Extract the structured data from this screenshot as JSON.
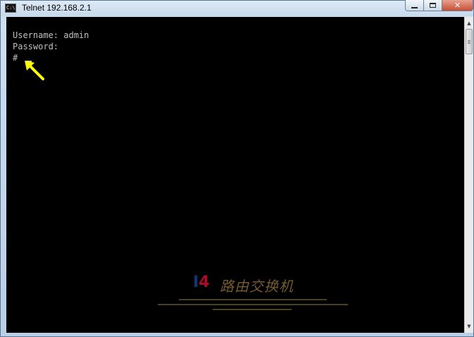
{
  "window": {
    "title": "Telnet 192.168.2.1",
    "icon_label": "C:\\",
    "controls": [
      "minimize-icon",
      "maximize-icon",
      "close-icon"
    ]
  },
  "console": {
    "lines": [
      "Username: admin",
      "Password:",
      "# "
    ],
    "cursor": "block-cursor",
    "annotation": "yellow-arrow-icon"
  },
  "watermark": {
    "logo_part1": "I",
    "logo_part2": "4",
    "brand": "路由交换机"
  },
  "colors": {
    "console_bg": "#000000",
    "console_text": "#c0c0c0",
    "arrow": "#ffff00",
    "titlebar": "#c6d8ec"
  }
}
